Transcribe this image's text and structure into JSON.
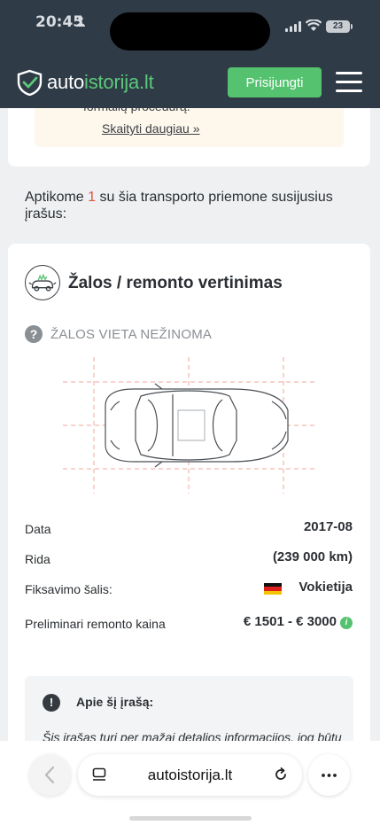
{
  "status_bar": {
    "time": "20:45",
    "battery": "23"
  },
  "header": {
    "logo_prefix": "auto",
    "logo_accent": "istorija.lt",
    "login_label": "Prisijungti",
    "colors": {
      "background": "#2f3b47",
      "accent": "#55c270"
    }
  },
  "notice": {
    "cut_text": "formalių procedūrą.",
    "read_more": "Skaityti daugiau »"
  },
  "found": {
    "prefix": "Aptikome ",
    "count": "1",
    "suffix": " su šia transporto priemone susijusius įrašus:"
  },
  "record": {
    "icon": "car-damage-icon",
    "title": "Žalos / remonto vertinimas",
    "damage_location": "ŽALOS VIETA NEŽINOMA",
    "details": {
      "date_label": "Data",
      "date_value": "2017-08",
      "mileage_label": "Rida",
      "mileage_value": "(239 000 km)",
      "country_label": "Fiksavimo šalis:",
      "country_value": "Vokietija",
      "price_label": "Preliminari remonto kaina",
      "price_value": "€ 1501 - € 3000"
    },
    "about": {
      "title": "Apie šį įrašą:",
      "body": "Šis įrašas turi per mažai detalios informacijos, jog būtų"
    }
  },
  "browser": {
    "url": "autoistorija.lt"
  }
}
